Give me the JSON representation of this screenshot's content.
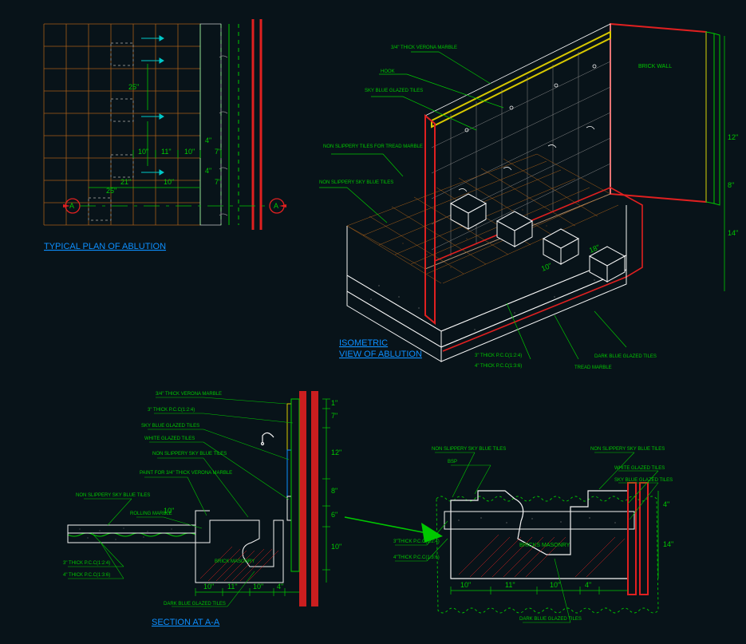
{
  "plan": {
    "title": "TYPICAL PLAN OF ABLUTION",
    "dims": {
      "d25a": "25\"",
      "d25b": "25\"",
      "d21": "21\"",
      "d10a": "10\"",
      "d11": "11\"",
      "d10b": "10\"",
      "d4a": "4\"",
      "d7a": "7\"",
      "d10c": "10\"",
      "d4b": "4\"",
      "d7b": "7\"",
      "sectA": "A"
    }
  },
  "iso": {
    "title": "ISOMETRIC",
    "subtitle": "VIEW OF ABLUTION",
    "labels": {
      "brick_wall": "BRICK WALL",
      "verona_marble": "3/4\" THICK VERONA MARBLE",
      "hook": "HOOK",
      "sky_tiles": "SKY BLUE GLAZED TILES",
      "non_slippery": "NON SLIPPERY TILES FOR TREAD MARBLE",
      "non_slippery_blue": "NON SLIPPERY SKY BLUE TILES",
      "dark_blue": "DARK BLUE GLAZED TILES",
      "pcc_a": "3\" THICK P.C.C(1:2:4)",
      "pcc_b": "4\" THICK P.C.C(1:3:6)",
      "tread_marble": "TREAD MARBLE"
    },
    "dims": {
      "d12": "12\"",
      "d8": "8\"",
      "d14": "14\"",
      "d10": "10\"",
      "d18": "18\""
    }
  },
  "section": {
    "title": "SECTION AT A-A",
    "labels": {
      "verona": "3/4\" THICK VERONA MARBLE",
      "pcc3": "3\" THICK P.C.C(1:2:4)",
      "sky_blue": "SKY BLUE GLAZED TILES",
      "white": "WHITE GLAZED TILES",
      "non_slippery": "NON SLIPPERY SKY BLUE TILES",
      "paint": "PAINT FOR 3/4\" THICK VERONA MARBLE",
      "non_slippery2": "NON SLIPPERY SKY BLUE TILES",
      "rolling_marble": "ROLLING MARBLE",
      "pcc3b": "3\" THICK P.C.C(1:2:4)",
      "pcc4": "4\" THICK P.C.C(1:3:6)",
      "brick_masonry": "BRICK MASONRY",
      "dark_blue": "DARK BLUE GLAZED TILES"
    },
    "dims": {
      "d1": "1\"",
      "d7": "7\"",
      "d12": "12\"",
      "d8": "8\"",
      "d6": "6\"",
      "d10v": "10\"",
      "d10a": "10\"",
      "d11": "11\"",
      "d10b": "10\"",
      "d4": "4\"",
      "d10p": "10\""
    }
  },
  "detail": {
    "labels": {
      "bsp": "BSP",
      "non_slippery": "NON SLIPPERY SKY BLUE TILES",
      "non_slippery2": "NON SLIPPERY SKY BLUE TILES",
      "pcc3": "3\"THICK P.C.C(1:2:4)",
      "pcc4": "4\"THICK P.C.C(1:3:6)",
      "brick_masonry": "BRICKS MASONRY",
      "white": "WHITE GLAZED TILES",
      "sky_blue": "SKY BLUE GLAZED TILES",
      "dark_blue": "DARK BLUE GLAZED TILES"
    },
    "dims": {
      "d10a": "10\"",
      "d11": "11\"",
      "d10b": "10\"",
      "d4": "4\"",
      "d4v": "4\"",
      "d14": "14\""
    }
  },
  "colors": {
    "bg": "#081319",
    "grid_orange": "#a65e18",
    "green": "#00c800",
    "red": "#e02020",
    "white": "#f4f4f4",
    "cyan": "#00c8c8",
    "yellow": "#d8c800",
    "blue": "#0d8fff",
    "gray_hatch": "#888888",
    "olive": "#606020"
  }
}
